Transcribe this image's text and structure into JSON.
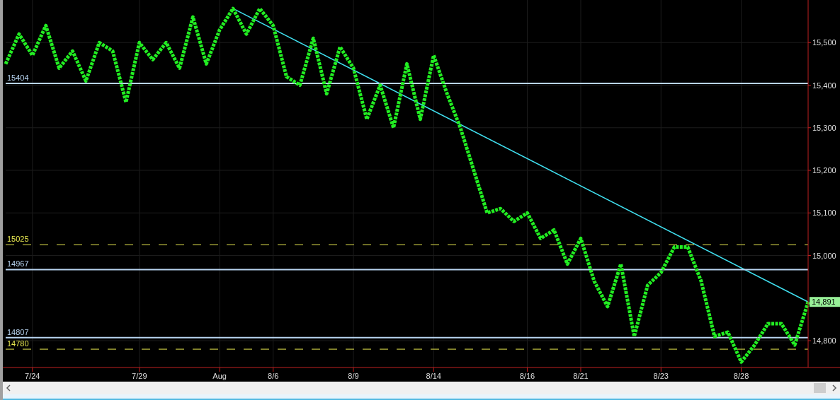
{
  "chart": {
    "chart_data": {
      "type": "line",
      "ylim": [
        14737,
        15600
      ],
      "categories": [
        null,
        null,
        "7/24",
        null,
        null,
        null,
        null,
        null,
        null,
        null,
        "7/29",
        null,
        null,
        null,
        null,
        null,
        "Aug",
        null,
        null,
        null,
        "8/6",
        null,
        null,
        null,
        null,
        null,
        "8/9",
        null,
        null,
        null,
        null,
        null,
        "8/14",
        null,
        null,
        null,
        null,
        null,
        null,
        "8/16",
        null,
        null,
        null,
        "8/21",
        null,
        null,
        null,
        null,
        null,
        "8/23",
        null,
        null,
        null,
        null,
        null,
        "8/28",
        null,
        null,
        null,
        null,
        null
      ],
      "yticks": [
        {
          "value": 14800,
          "label": "14,800"
        },
        {
          "value": 15000,
          "label": "15,000"
        },
        {
          "value": 15100,
          "label": "15,100"
        },
        {
          "value": 15200,
          "label": "15,200"
        },
        {
          "value": 15300,
          "label": "15,300"
        },
        {
          "value": 15400,
          "label": "15,400"
        },
        {
          "value": 15500,
          "label": "15,500"
        }
      ],
      "grid": true,
      "series": [
        {
          "color": "#22ee22",
          "line_style": "dashed",
          "values": [
            15450,
            15520,
            15470,
            15540,
            15440,
            15480,
            15410,
            15500,
            15480,
            15360,
            15500,
            15460,
            15500,
            15440,
            15560,
            15450,
            15530,
            15580,
            15520,
            15580,
            15540,
            15420,
            15400,
            15510,
            15380,
            15490,
            15440,
            15320,
            15400,
            15300,
            15450,
            15320,
            15470,
            15380,
            15300,
            15200,
            15100,
            15110,
            15080,
            15100,
            15040,
            15060,
            14980,
            15040,
            14940,
            14880,
            14980,
            14810,
            14930,
            14960,
            15020,
            15020,
            14940,
            14810,
            14820,
            14750,
            14790,
            14840,
            14840,
            14790,
            14891
          ]
        }
      ],
      "ref_lines": [
        {
          "axis": "y",
          "value": 15404,
          "label": "15404",
          "color": "#b8d4f0",
          "line_style": "solid"
        },
        {
          "axis": "y",
          "value": 15025,
          "label": "15025",
          "color": "#e8e850",
          "line_style": "dashed"
        },
        {
          "axis": "y",
          "value": 14967,
          "label": "14967",
          "color": "#b8d4f0",
          "line_style": "solid"
        },
        {
          "axis": "y",
          "value": 14807,
          "label": "14807",
          "color": "#b8d4f0",
          "line_style": "solid"
        },
        {
          "axis": "y",
          "value": 14780,
          "label": "14780",
          "color": "#e8e850",
          "line_style": "dashed"
        }
      ]
    },
    "last_price": "14,891"
  }
}
